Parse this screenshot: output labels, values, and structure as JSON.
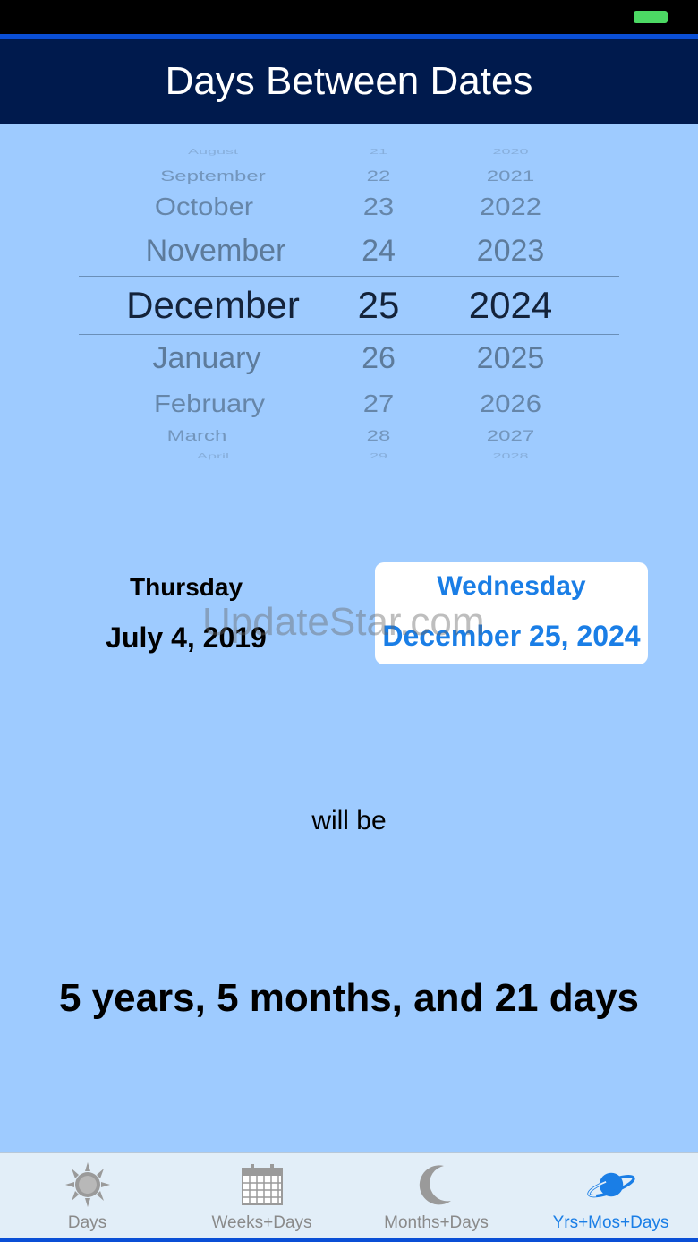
{
  "nav": {
    "title": "Days Between Dates"
  },
  "picker": {
    "months": [
      "August",
      "September",
      "October",
      "November",
      "December",
      "January",
      "February",
      "March",
      "April"
    ],
    "days": [
      "21",
      "22",
      "23",
      "24",
      "25",
      "26",
      "27",
      "28",
      "29"
    ],
    "years": [
      "2020",
      "2021",
      "2022",
      "2023",
      "2024",
      "2025",
      "2026",
      "2027",
      "2028"
    ],
    "selected": {
      "month": "December",
      "day": "25",
      "year": "2024"
    }
  },
  "start": {
    "weekday": "Thursday",
    "date": "July 4, 2019"
  },
  "end": {
    "weekday": "Wednesday",
    "date": "December 25, 2024"
  },
  "watermark": "UpdateStar.com",
  "will_be": "will be",
  "result": "5 years, 5 months, and 21 days",
  "tabs": [
    {
      "label": "Days",
      "icon": "sun-icon"
    },
    {
      "label": "Weeks+Days",
      "icon": "calendar-icon"
    },
    {
      "label": "Months+Days",
      "icon": "moon-icon"
    },
    {
      "label": "Yrs+Mos+Days",
      "icon": "planet-icon",
      "active": true
    }
  ],
  "colors": {
    "background": "#9ecbff",
    "nav": "#001a4d",
    "accent": "#1a7ee6",
    "battery": "#4cd964"
  }
}
